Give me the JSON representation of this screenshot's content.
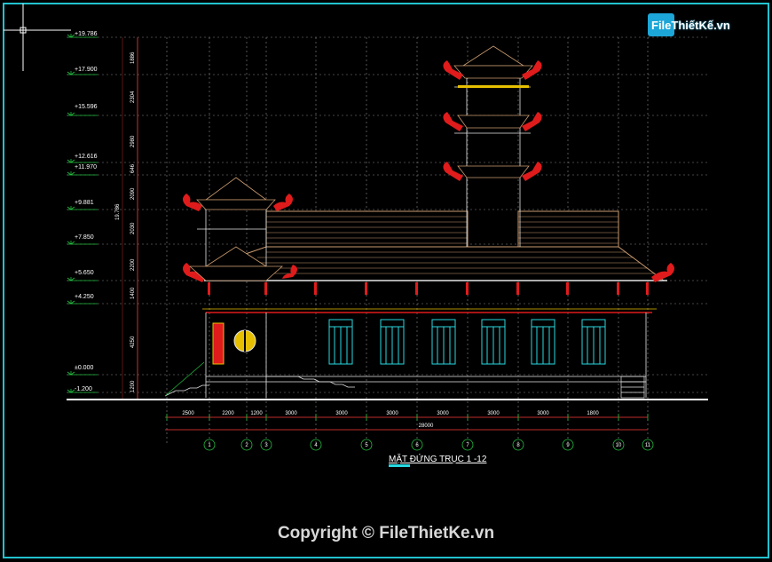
{
  "watermark": {
    "logo_text": "FileThiếtKế.vn",
    "copyright": "Copyright © FileThietKe.vn"
  },
  "drawing": {
    "title": "MẶT ĐỨNG TRỤC 1 -12",
    "levels": [
      "+19.786",
      "+17.900",
      "+15.596",
      "+12.616",
      "+11.970",
      "+9.881",
      "+7.850",
      "+5.650",
      "+4.250",
      "±0.000",
      "-1.200"
    ],
    "vertical_dims": [
      "1886",
      "2304",
      "2980",
      "646",
      "2090",
      "2030",
      "2200",
      "1400",
      "4250",
      "1200"
    ],
    "total_height": "19.786",
    "bottom_dims": [
      "2500",
      "2200",
      "1200",
      "3000",
      "3000",
      "3000",
      "3000",
      "3000",
      "3000",
      "1800"
    ],
    "total_width": "28000",
    "axes": [
      "1",
      "2",
      "3",
      "4",
      "5",
      "6",
      "7",
      "8",
      "9",
      "10",
      "11"
    ]
  },
  "colors": {
    "frame": "#22c3cf",
    "grid": "#9a9a9a",
    "roof": "#c99a6f",
    "dragon": "#e01b1b",
    "window": "#28d8e0",
    "dim": "#ff3b3b",
    "axis": "#23c040",
    "level": "#23c040",
    "text": "#ffffff",
    "wall": "#e6e6e6"
  }
}
